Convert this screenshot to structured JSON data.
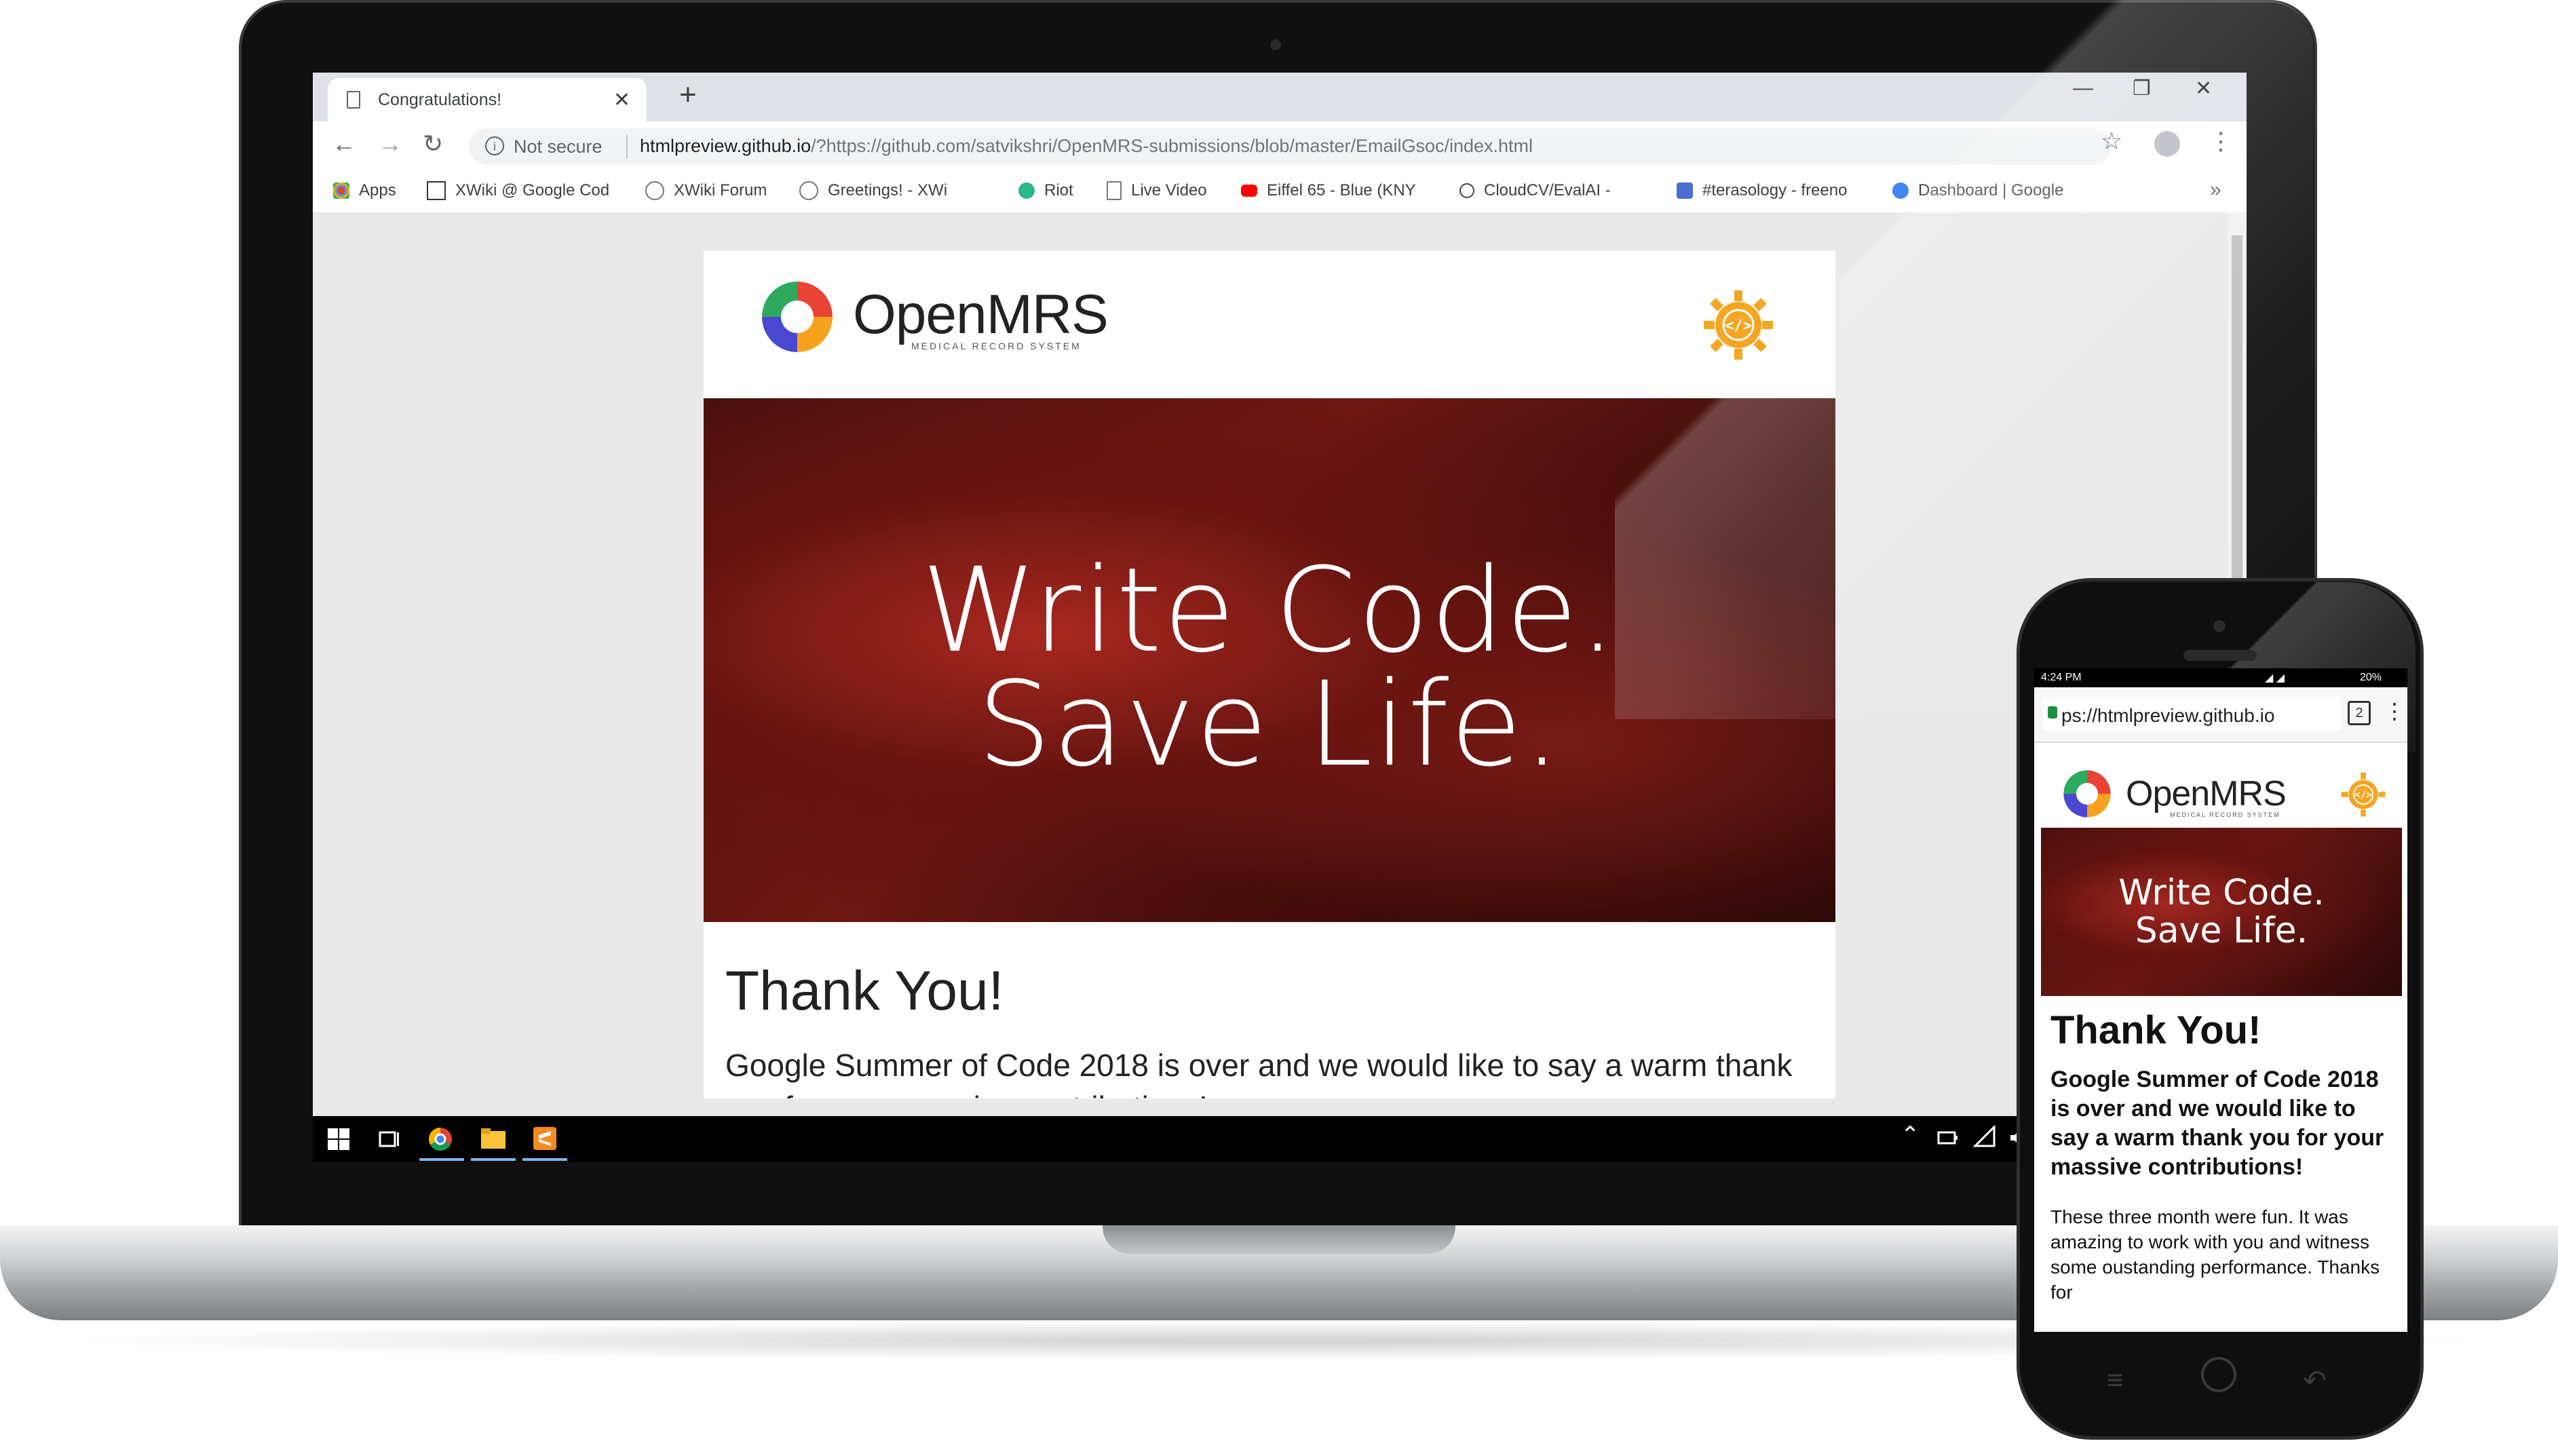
{
  "browser": {
    "tab_title": "Congratulations!",
    "new_tab": "+",
    "close_tab": "✕",
    "window_controls": [
      "—",
      "❐",
      "✕"
    ],
    "nav": {
      "back": "←",
      "forward": "→",
      "reload": "↻"
    },
    "security_label": "Not secure",
    "url_host": "htmlpreview.github.io",
    "url_rest": "/?https://github.com/satvikshri/OpenMRS-submissions/blob/master/EmailGsoc/index.html",
    "bookmarks": [
      {
        "label": "Apps",
        "icon": "apps-grid-icon",
        "color": "#e94235"
      },
      {
        "label": "XWiki @ Google Cod",
        "icon": "xwiki-icon",
        "color": "#333333"
      },
      {
        "label": "XWiki Forum",
        "icon": "forum-icon",
        "color": "#777777"
      },
      {
        "label": "Greetings! - XWi",
        "icon": "cat-icon",
        "color": "#333333"
      },
      {
        "label": "Riot",
        "icon": "riot-icon",
        "color": "#2db88a"
      },
      {
        "label": "Live Video",
        "icon": "page-icon",
        "color": "#777777"
      },
      {
        "label": "Eiffel 65 - Blue (KNY",
        "icon": "youtube-icon",
        "color": "#ff0000"
      },
      {
        "label": "CloudCV/EvalAI -",
        "icon": "github-icon",
        "color": "#444444"
      },
      {
        "label": "#terasology - freeno",
        "icon": "irc-icon",
        "color": "#4a6fd1"
      },
      {
        "label": "Dashboard | Google",
        "icon": "gear-icon",
        "color": "#4285f4"
      }
    ],
    "bookmarks_more": "»"
  },
  "email": {
    "brand": "OpenMRS",
    "brand_sub": "MEDICAL RECORD SYSTEM",
    "hero_line1": "Write Code.",
    "hero_line2": "Save Life.",
    "heading": "Thank You!",
    "body": "Google Summer of Code 2018 is over and we would like to say a warm thank you for your massive contributions!"
  },
  "phone": {
    "time": "4:24 PM",
    "battery": "20%",
    "url": "ps://htmlpreview.github.io",
    "tabs_count": "2",
    "lead": "Google Summer of Code 2018 is over and we would like to say a warm thank you for your massive contributions!",
    "body": "These three month were fun. It was amazing to work with you and witness some oustanding performance. Thanks for"
  },
  "colors": {
    "hero_red": "#6e1813",
    "gsoc_orange": "#f5a623",
    "taskbar_accent": "#76b9ed"
  }
}
